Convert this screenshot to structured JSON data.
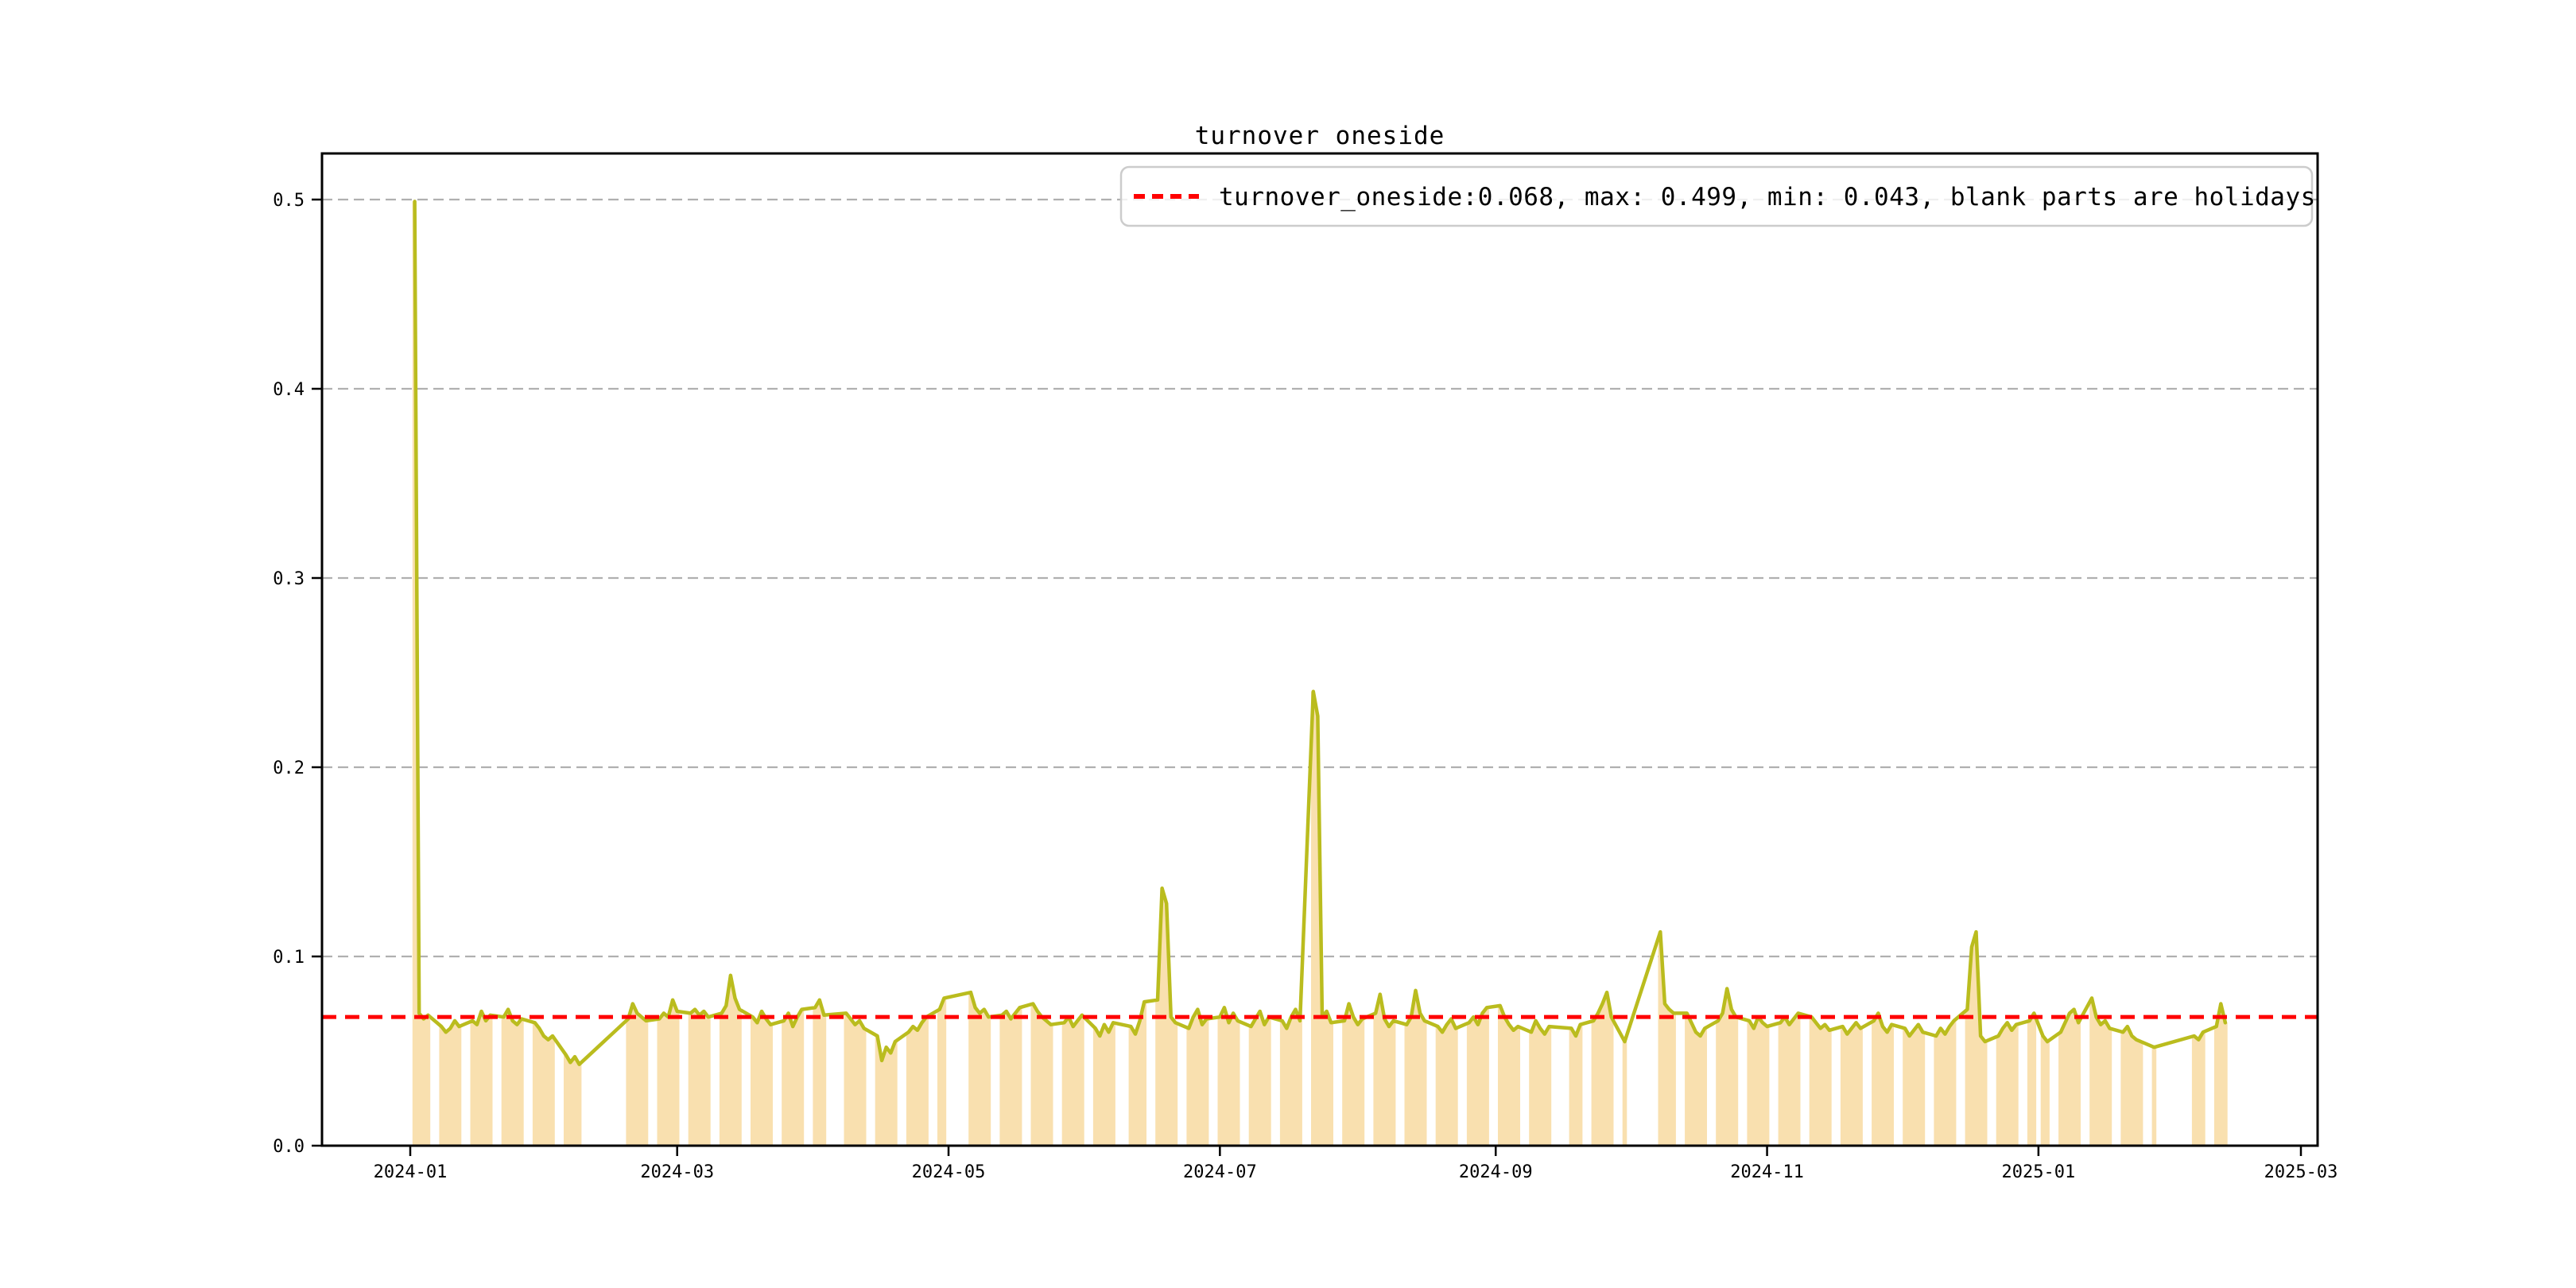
{
  "figure": {
    "title": "turnover oneside"
  },
  "legend": {
    "label": "turnover_oneside:0.068, max: 0.499, min: 0.043, blank parts are holidays"
  },
  "axes": {
    "x_ticks": [
      {
        "label": "2024-01",
        "date": "2024-01-01"
      },
      {
        "label": "2024-03",
        "date": "2024-03-01"
      },
      {
        "label": "2024-05",
        "date": "2024-05-01"
      },
      {
        "label": "2024-07",
        "date": "2024-07-01"
      },
      {
        "label": "2024-09",
        "date": "2024-09-01"
      },
      {
        "label": "2024-11",
        "date": "2024-11-01"
      },
      {
        "label": "2025-01",
        "date": "2025-01-01"
      },
      {
        "label": "2025-03",
        "date": "2025-03-01"
      }
    ],
    "y_ticks": [
      {
        "label": "0.0",
        "value": 0.0
      },
      {
        "label": "0.1",
        "value": 0.1
      },
      {
        "label": "0.2",
        "value": 0.2
      },
      {
        "label": "0.3",
        "value": 0.3
      },
      {
        "label": "0.4",
        "value": 0.4
      },
      {
        "label": "0.5",
        "value": 0.5
      }
    ]
  },
  "colors": {
    "line": "#babc1e",
    "fill": "#f9e0af",
    "threshold": "#ff0000",
    "grid": "#b0b0b0",
    "spine": "#000000",
    "legend_border": "#cccccc"
  },
  "chart_data": {
    "type": "area",
    "title": "turnover oneside",
    "series_name": "turnover_oneside",
    "xlabel": "",
    "ylabel": "",
    "x_range": [
      "2024-01-01",
      "2025-03-01"
    ],
    "ylim": [
      0.0,
      0.524
    ],
    "grid": "horizontal-dashed",
    "legend_position": "upper right",
    "threshold": 0.068,
    "stats": {
      "current": 0.068,
      "max": 0.499,
      "min": 0.043
    },
    "note": "blank parts are holidays",
    "dates": [
      "2024-01-02",
      "2024-01-03",
      "2024-01-04",
      "2024-01-05",
      "2024-01-08",
      "2024-01-09",
      "2024-01-10",
      "2024-01-11",
      "2024-01-12",
      "2024-01-15",
      "2024-01-16",
      "2024-01-17",
      "2024-01-18",
      "2024-01-19",
      "2024-01-22",
      "2024-01-23",
      "2024-01-24",
      "2024-01-25",
      "2024-01-26",
      "2024-01-29",
      "2024-01-30",
      "2024-01-31",
      "2024-02-01",
      "2024-02-02",
      "2024-02-05",
      "2024-02-06",
      "2024-02-07",
      "2024-02-08",
      "2024-02-19",
      "2024-02-20",
      "2024-02-21",
      "2024-02-22",
      "2024-02-23",
      "2024-02-26",
      "2024-02-27",
      "2024-02-28",
      "2024-02-29",
      "2024-03-01",
      "2024-03-04",
      "2024-03-05",
      "2024-03-06",
      "2024-03-07",
      "2024-03-08",
      "2024-03-11",
      "2024-03-12",
      "2024-03-13",
      "2024-03-14",
      "2024-03-15",
      "2024-03-18",
      "2024-03-19",
      "2024-03-20",
      "2024-03-21",
      "2024-03-22",
      "2024-03-25",
      "2024-03-26",
      "2024-03-27",
      "2024-03-28",
      "2024-03-29",
      "2024-04-01",
      "2024-04-02",
      "2024-04-03",
      "2024-04-08",
      "2024-04-09",
      "2024-04-10",
      "2024-04-11",
      "2024-04-12",
      "2024-04-15",
      "2024-04-16",
      "2024-04-17",
      "2024-04-18",
      "2024-04-19",
      "2024-04-22",
      "2024-04-23",
      "2024-04-24",
      "2024-04-25",
      "2024-04-26",
      "2024-04-29",
      "2024-04-30",
      "2024-05-06",
      "2024-05-07",
      "2024-05-08",
      "2024-05-09",
      "2024-05-10",
      "2024-05-13",
      "2024-05-14",
      "2024-05-15",
      "2024-05-16",
      "2024-05-17",
      "2024-05-20",
      "2024-05-21",
      "2024-05-22",
      "2024-05-23",
      "2024-05-24",
      "2024-05-27",
      "2024-05-28",
      "2024-05-29",
      "2024-05-30",
      "2024-05-31",
      "2024-06-03",
      "2024-06-04",
      "2024-06-05",
      "2024-06-06",
      "2024-06-07",
      "2024-06-11",
      "2024-06-12",
      "2024-06-13",
      "2024-06-14",
      "2024-06-17",
      "2024-06-18",
      "2024-06-19",
      "2024-06-20",
      "2024-06-21",
      "2024-06-24",
      "2024-06-25",
      "2024-06-26",
      "2024-06-27",
      "2024-06-28",
      "2024-07-01",
      "2024-07-02",
      "2024-07-03",
      "2024-07-04",
      "2024-07-05",
      "2024-07-08",
      "2024-07-09",
      "2024-07-10",
      "2024-07-11",
      "2024-07-12",
      "2024-07-15",
      "2024-07-16",
      "2024-07-17",
      "2024-07-18",
      "2024-07-19",
      "2024-07-22",
      "2024-07-23",
      "2024-07-24",
      "2024-07-25",
      "2024-07-26",
      "2024-07-29",
      "2024-07-30",
      "2024-07-31",
      "2024-08-01",
      "2024-08-02",
      "2024-08-05",
      "2024-08-06",
      "2024-08-07",
      "2024-08-08",
      "2024-08-09",
      "2024-08-12",
      "2024-08-13",
      "2024-08-14",
      "2024-08-15",
      "2024-08-16",
      "2024-08-19",
      "2024-08-20",
      "2024-08-21",
      "2024-08-22",
      "2024-08-23",
      "2024-08-26",
      "2024-08-27",
      "2024-08-28",
      "2024-08-29",
      "2024-08-30",
      "2024-09-02",
      "2024-09-03",
      "2024-09-04",
      "2024-09-05",
      "2024-09-06",
      "2024-09-09",
      "2024-09-10",
      "2024-09-11",
      "2024-09-12",
      "2024-09-13",
      "2024-09-18",
      "2024-09-19",
      "2024-09-20",
      "2024-09-23",
      "2024-09-24",
      "2024-09-25",
      "2024-09-26",
      "2024-09-27",
      "2024-09-30",
      "2024-10-08",
      "2024-10-09",
      "2024-10-10",
      "2024-10-11",
      "2024-10-14",
      "2024-10-15",
      "2024-10-16",
      "2024-10-17",
      "2024-10-18",
      "2024-10-21",
      "2024-10-22",
      "2024-10-23",
      "2024-10-24",
      "2024-10-25",
      "2024-10-28",
      "2024-10-29",
      "2024-10-30",
      "2024-10-31",
      "2024-11-01",
      "2024-11-04",
      "2024-11-05",
      "2024-11-06",
      "2024-11-07",
      "2024-11-08",
      "2024-11-11",
      "2024-11-12",
      "2024-11-13",
      "2024-11-14",
      "2024-11-15",
      "2024-11-18",
      "2024-11-19",
      "2024-11-20",
      "2024-11-21",
      "2024-11-22",
      "2024-11-25",
      "2024-11-26",
      "2024-11-27",
      "2024-11-28",
      "2024-11-29",
      "2024-12-02",
      "2024-12-03",
      "2024-12-04",
      "2024-12-05",
      "2024-12-06",
      "2024-12-09",
      "2024-12-10",
      "2024-12-11",
      "2024-12-12",
      "2024-12-13",
      "2024-12-16",
      "2024-12-17",
      "2024-12-18",
      "2024-12-19",
      "2024-12-20",
      "2024-12-23",
      "2024-12-24",
      "2024-12-25",
      "2024-12-26",
      "2024-12-27",
      "2024-12-30",
      "2024-12-31",
      "2025-01-02",
      "2025-01-03",
      "2025-01-06",
      "2025-01-07",
      "2025-01-08",
      "2025-01-09",
      "2025-01-10",
      "2025-01-13",
      "2025-01-14",
      "2025-01-15",
      "2025-01-16",
      "2025-01-17",
      "2025-01-20",
      "2025-01-21",
      "2025-01-22",
      "2025-01-23",
      "2025-01-24",
      "2025-01-27",
      "2025-02-05",
      "2025-02-06",
      "2025-02-07",
      "2025-02-10",
      "2025-02-11",
      "2025-02-12"
    ],
    "values": [
      0.499,
      0.07,
      0.067,
      0.069,
      0.063,
      0.06,
      0.062,
      0.066,
      0.063,
      0.066,
      0.064,
      0.071,
      0.066,
      0.069,
      0.068,
      0.072,
      0.066,
      0.064,
      0.067,
      0.065,
      0.062,
      0.058,
      0.056,
      0.058,
      0.048,
      0.044,
      0.047,
      0.043,
      0.067,
      0.075,
      0.07,
      0.068,
      0.066,
      0.067,
      0.07,
      0.068,
      0.077,
      0.071,
      0.07,
      0.072,
      0.069,
      0.071,
      0.068,
      0.07,
      0.074,
      0.09,
      0.078,
      0.072,
      0.068,
      0.065,
      0.071,
      0.067,
      0.064,
      0.066,
      0.07,
      0.063,
      0.068,
      0.072,
      0.073,
      0.077,
      0.069,
      0.07,
      0.067,
      0.064,
      0.066,
      0.062,
      0.058,
      0.045,
      0.052,
      0.049,
      0.055,
      0.06,
      0.063,
      0.061,
      0.065,
      0.068,
      0.072,
      0.078,
      0.081,
      0.073,
      0.07,
      0.072,
      0.068,
      0.069,
      0.071,
      0.067,
      0.07,
      0.073,
      0.075,
      0.071,
      0.068,
      0.066,
      0.064,
      0.065,
      0.068,
      0.063,
      0.066,
      0.069,
      0.062,
      0.058,
      0.064,
      0.06,
      0.065,
      0.063,
      0.059,
      0.066,
      0.076,
      0.077,
      0.136,
      0.128,
      0.068,
      0.065,
      0.062,
      0.068,
      0.072,
      0.064,
      0.067,
      0.068,
      0.073,
      0.065,
      0.07,
      0.066,
      0.063,
      0.067,
      0.071,
      0.064,
      0.068,
      0.066,
      0.062,
      0.068,
      0.072,
      0.066,
      0.24,
      0.227,
      0.068,
      0.071,
      0.065,
      0.066,
      0.075,
      0.068,
      0.064,
      0.067,
      0.07,
      0.08,
      0.067,
      0.063,
      0.066,
      0.064,
      0.068,
      0.082,
      0.07,
      0.066,
      0.063,
      0.06,
      0.064,
      0.067,
      0.062,
      0.065,
      0.068,
      0.064,
      0.07,
      0.073,
      0.074,
      0.068,
      0.064,
      0.061,
      0.063,
      0.06,
      0.066,
      0.062,
      0.059,
      0.063,
      0.062,
      0.058,
      0.064,
      0.066,
      0.07,
      0.075,
      0.081,
      0.068,
      0.055,
      0.113,
      0.075,
      0.072,
      0.07,
      0.07,
      0.065,
      0.06,
      0.058,
      0.062,
      0.066,
      0.07,
      0.083,
      0.072,
      0.068,
      0.066,
      0.062,
      0.068,
      0.065,
      0.063,
      0.065,
      0.068,
      0.064,
      0.067,
      0.07,
      0.068,
      0.065,
      0.062,
      0.064,
      0.061,
      0.063,
      0.059,
      0.062,
      0.065,
      0.062,
      0.066,
      0.07,
      0.063,
      0.06,
      0.064,
      0.062,
      0.058,
      0.061,
      0.064,
      0.06,
      0.058,
      0.062,
      0.059,
      0.063,
      0.066,
      0.072,
      0.105,
      0.113,
      0.058,
      0.055,
      0.058,
      0.062,
      0.065,
      0.061,
      0.064,
      0.066,
      0.07,
      0.058,
      0.055,
      0.06,
      0.065,
      0.07,
      0.072,
      0.065,
      0.078,
      0.068,
      0.064,
      0.066,
      0.062,
      0.06,
      0.063,
      0.058,
      0.056,
      0.055,
      0.052,
      0.058,
      0.056,
      0.06,
      0.063,
      0.075,
      0.065
    ]
  }
}
